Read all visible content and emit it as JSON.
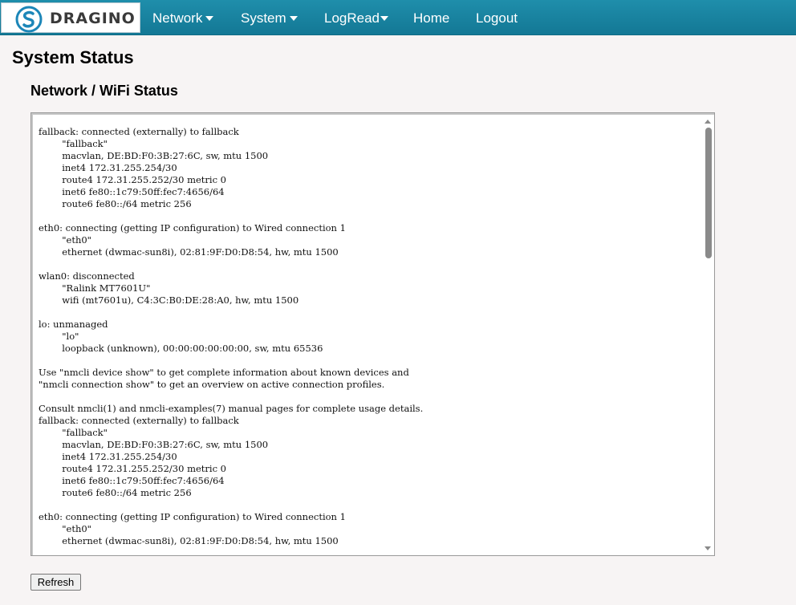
{
  "brand": {
    "name": "DRAGINO"
  },
  "nav": {
    "items": [
      {
        "label": "Network",
        "has_dropdown": true
      },
      {
        "label": "System",
        "has_dropdown": true
      },
      {
        "label": "LogRead",
        "has_dropdown": true
      },
      {
        "label": "Home",
        "has_dropdown": false
      },
      {
        "label": "Logout",
        "has_dropdown": false
      }
    ]
  },
  "page": {
    "title": "System Status",
    "section_title": "Network / WiFi Status",
    "status_text": "fallback: connected (externally) to fallback\n        \"fallback\"\n        macvlan, DE:BD:F0:3B:27:6C, sw, mtu 1500\n        inet4 172.31.255.254/30\n        route4 172.31.255.252/30 metric 0\n        inet6 fe80::1c79:50ff:fec7:4656/64\n        route6 fe80::/64 metric 256\n\neth0: connecting (getting IP configuration) to Wired connection 1\n        \"eth0\"\n        ethernet (dwmac-sun8i), 02:81:9F:D0:D8:54, hw, mtu 1500\n\nwlan0: disconnected\n        \"Ralink MT7601U\"\n        wifi (mt7601u), C4:3C:B0:DE:28:A0, hw, mtu 1500\n\nlo: unmanaged\n        \"lo\"\n        loopback (unknown), 00:00:00:00:00:00, sw, mtu 65536\n\nUse \"nmcli device show\" to get complete information about known devices and\n\"nmcli connection show\" to get an overview on active connection profiles.\n\nConsult nmcli(1) and nmcli-examples(7) manual pages for complete usage details.\nfallback: connected (externally) to fallback\n        \"fallback\"\n        macvlan, DE:BD:F0:3B:27:6C, sw, mtu 1500\n        inet4 172.31.255.254/30\n        route4 172.31.255.252/30 metric 0\n        inet6 fe80::1c79:50ff:fec7:4656/64\n        route6 fe80::/64 metric 256\n\neth0: connecting (getting IP configuration) to Wired connection 1\n        \"eth0\"\n        ethernet (dwmac-sun8i), 02:81:9F:D0:D8:54, hw, mtu 1500",
    "refresh_label": "Refresh"
  },
  "colors": {
    "navbar": "#137895",
    "background": "#f7f4f4",
    "logo_blue": "#1c86b8"
  }
}
